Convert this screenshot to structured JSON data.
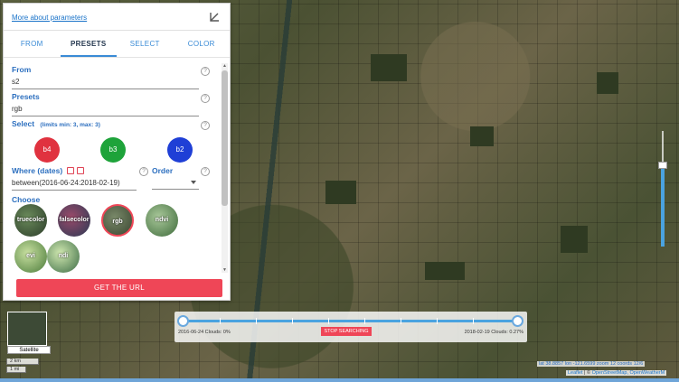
{
  "panel": {
    "more_link": "More about parameters",
    "tabs": [
      {
        "label": "FROM"
      },
      {
        "label": "PRESETS"
      },
      {
        "label": "SELECT"
      },
      {
        "label": "COLOR"
      }
    ],
    "from": {
      "label": "From",
      "value": "s2"
    },
    "presets": {
      "label": "Presets",
      "value": "rgb"
    },
    "select": {
      "label": "Select",
      "limits": "(limits min: 3, max: 3)"
    },
    "bands": [
      {
        "label": "b4",
        "color": "#e0323f"
      },
      {
        "label": "b3",
        "color": "#1ea33a"
      },
      {
        "label": "b2",
        "color": "#1f3fd6"
      }
    ],
    "where": {
      "label": "Where (dates)",
      "value": "between(2016-06-24:2018-02-19)"
    },
    "order": {
      "label": "Order"
    },
    "choose": {
      "label": "Choose"
    },
    "preset_items": [
      {
        "label": "truecolor"
      },
      {
        "label": "falsecolor"
      },
      {
        "label": "rgb"
      },
      {
        "label": "ndvi"
      },
      {
        "label": "evi"
      },
      {
        "label": "ndi"
      }
    ],
    "get_url": "GET THE URL",
    "help_glyph": "?"
  },
  "timeline": {
    "start_text": "2016-06-24 Clouds: 0%",
    "end_text": "2018-02-19 Clouds: 0.27%",
    "stop_label": "STOP SEARCHING"
  },
  "map": {
    "layer_button": "Satellite",
    "scale_km": "2 km",
    "scale_mi": "1 mi",
    "coords": "lat 38.8857 lon -121.6599 zoom 12  coords  12/6",
    "attrib_leaflet": "Leaflet",
    "attrib_sep": " | © ",
    "attrib_osm": "OpenStreetMap, OpenWeatherM"
  }
}
